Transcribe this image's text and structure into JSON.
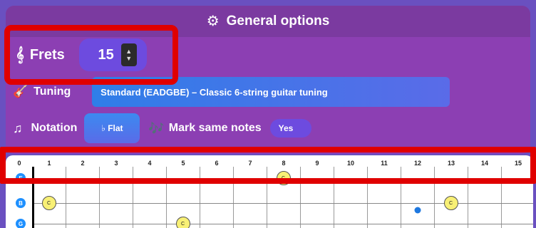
{
  "panel": {
    "title": "General options",
    "gear_icon": "gear-icon"
  },
  "frets": {
    "label": "Frets",
    "icon": "treble-clef-icon",
    "value": "15"
  },
  "tuning": {
    "label": "Tuning",
    "icon": "guitar-icon",
    "selected": "Standard (EADGBE) – Classic 6-string guitar tuning"
  },
  "notation": {
    "label": "Notation",
    "icon": "music-note-icon",
    "selected": "♭ Flat"
  },
  "mark_same": {
    "label": "Mark same notes",
    "icon": "music-notes-icon",
    "value": "Yes"
  },
  "fretboard": {
    "fret_numbers": [
      "0",
      "1",
      "2",
      "3",
      "4",
      "5",
      "6",
      "7",
      "8",
      "9",
      "10",
      "11",
      "12",
      "13",
      "14",
      "15"
    ],
    "open_strings": [
      "E",
      "B",
      "G"
    ],
    "notes": [
      {
        "string": 0,
        "fret": 8,
        "label": "C"
      },
      {
        "string": 1,
        "fret": 1,
        "label": "C"
      },
      {
        "string": 1,
        "fret": 13,
        "label": "C"
      },
      {
        "string": 2,
        "fret": 5,
        "label": "C"
      }
    ],
    "markers": [
      {
        "string": 1,
        "fret": 12
      }
    ]
  },
  "colors": {
    "highlight": "#e00000",
    "panel": "#8c3fb3",
    "accent": "#6d4bdf",
    "note_fill": "#f8f075",
    "open_string": "#1e90ff"
  }
}
